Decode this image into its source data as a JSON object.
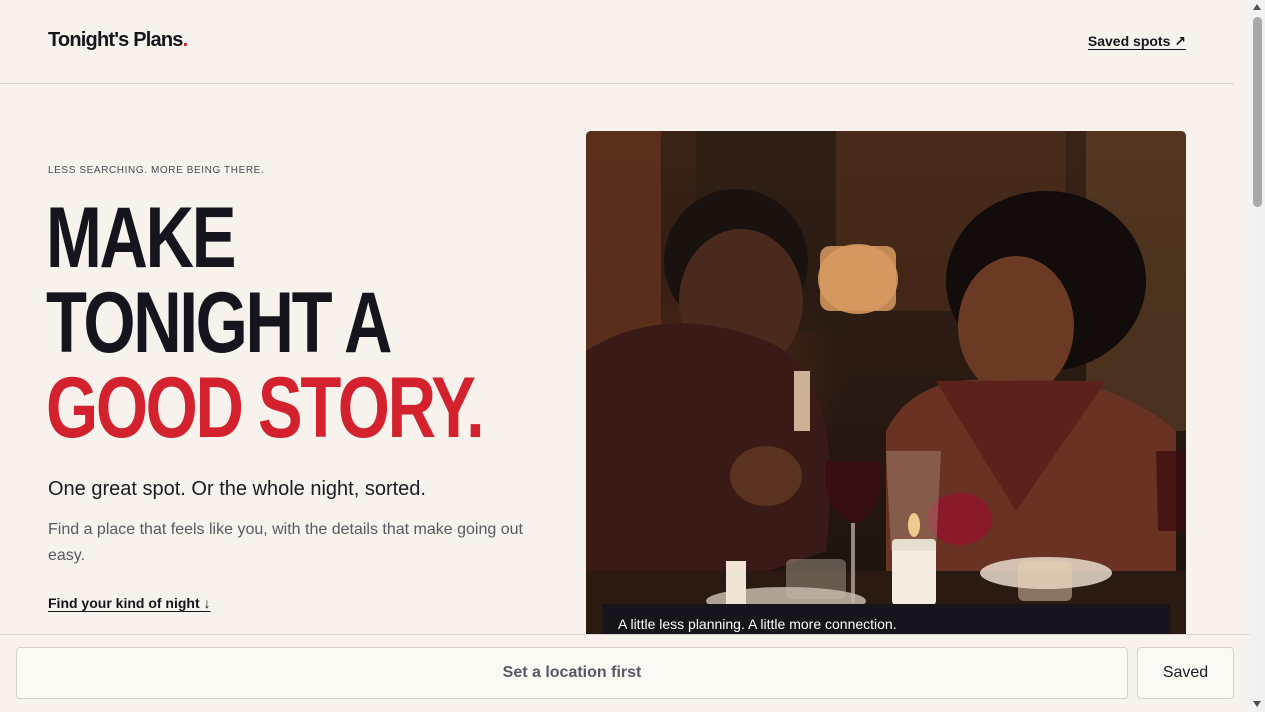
{
  "header": {
    "logo_text": "Tonight's Plans",
    "logo_dot": ".",
    "saved_link": "Saved spots ↗"
  },
  "hero": {
    "eyebrow": "LESS SEARCHING. MORE BEING THERE.",
    "headline_line1": "MAKE",
    "headline_line2": "TONIGHT A",
    "headline_accent": "GOOD STORY.",
    "subhead": "One great spot. Or the whole night, sorted.",
    "body": "Find a place that feels like you, with the details that make going out easy.",
    "cta_link": "Find your kind of night ↓"
  },
  "photo": {
    "caption": "A little less planning. A little more connection."
  },
  "bottom_bar": {
    "location_button": "Set a location first",
    "saved_button": "Saved"
  },
  "colors": {
    "background": "#f7f3ec",
    "accent": "#d3222e",
    "ink": "#16141c"
  }
}
